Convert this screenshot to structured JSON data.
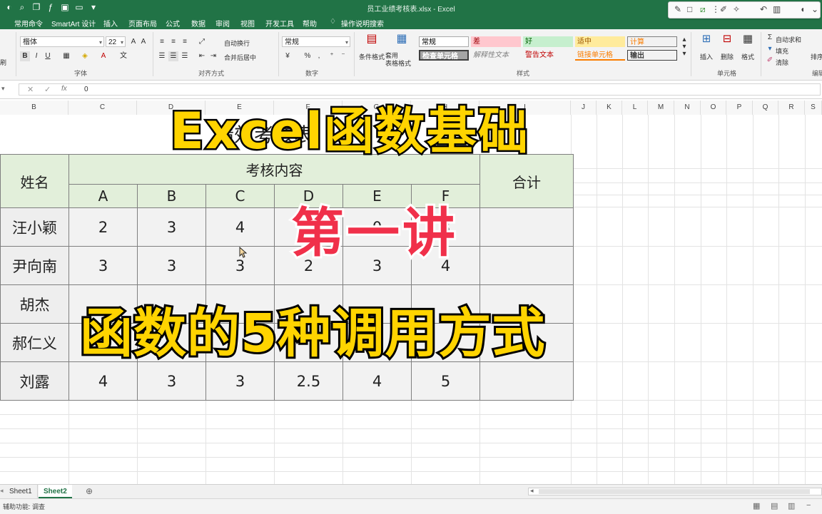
{
  "window": {
    "title": "员工业绩考核表.xlsx  -  Excel",
    "quick_access": [
      "autosave-icon",
      "undo-icon",
      "redo-icon",
      "save-icon",
      "more-icon"
    ]
  },
  "ribbon_tabs": [
    "常用命令",
    "SmartArt 设计",
    "插入",
    "页面布局",
    "公式",
    "数据",
    "审阅",
    "视图",
    "开发工具",
    "帮助",
    "操作说明搜索"
  ],
  "ribbon": {
    "font": {
      "name": "楷体",
      "size": "22",
      "group_label": "字体"
    },
    "alignment": {
      "wrap_text": "自动换行",
      "merge_center": "合并后居中",
      "group_label": "对齐方式"
    },
    "number": {
      "format": "常规",
      "percent": "%",
      "comma": ",",
      "group_label": "数字"
    },
    "styles": {
      "conditional_format": "条件格式",
      "table_format": "套用\n表格格式",
      "cells": [
        {
          "label": "常规",
          "bg": "#ffffff",
          "fg": "#000000"
        },
        {
          "label": "差",
          "bg": "#ffc7ce",
          "fg": "#9c0006"
        },
        {
          "label": "好",
          "bg": "#c6efce",
          "fg": "#006100"
        },
        {
          "label": "适中",
          "bg": "#ffeb9c",
          "fg": "#9c5700"
        },
        {
          "label": "计算",
          "bg": "#f2f2f2",
          "fg": "#fa7d00"
        },
        {
          "label": "检查单元格",
          "bg": "#a5a5a5",
          "fg": "#ffffff"
        },
        {
          "label": "解释性文本",
          "bg": "#f3f3f3",
          "fg": "#7f7f7f"
        },
        {
          "label": "警告文本",
          "bg": "#f3f3f3",
          "fg": "#c00000"
        },
        {
          "label": "链接单元格",
          "bg": "#f3f3f3",
          "fg": "#fa7d00"
        },
        {
          "label": "输出",
          "bg": "#f2f2f2",
          "fg": "#3f3f3f"
        }
      ],
      "group_label": "样式"
    },
    "cells_group": {
      "insert": "插入",
      "delete": "删除",
      "format": "格式",
      "group_label": "单元格"
    },
    "editing": {
      "autosum": "自动求和",
      "fill": "填充",
      "clear": "清除",
      "sort": "排序",
      "group_label": "编辑"
    },
    "clipboard_label": "剪贴板"
  },
  "formula_bar": {
    "value": "0",
    "fx": "fx"
  },
  "columns": [
    "B",
    "C",
    "D",
    "E",
    "F",
    "G",
    "H",
    "I",
    "J",
    "K",
    "L",
    "M",
    "N",
    "O",
    "P",
    "Q",
    "R",
    "S"
  ],
  "sheet": {
    "title": "绩效考核表",
    "header_name": "姓名",
    "header_group": "考核内容",
    "header_total": "合计",
    "sub_headers": [
      "A",
      "B",
      "C",
      "D",
      "E",
      "F"
    ],
    "rows": [
      {
        "name": "汪小颖",
        "values": [
          "2",
          "3",
          "4",
          "2",
          "0",
          "3"
        ],
        "total": ""
      },
      {
        "name": "尹向南",
        "values": [
          "3",
          "3",
          "3",
          "2",
          "3",
          "4"
        ],
        "total": ""
      },
      {
        "name": "胡杰",
        "values": [
          "",
          "",
          "",
          "",
          "",
          ""
        ],
        "total": ""
      },
      {
        "name": "郝仁义",
        "values": [
          "",
          "",
          "",
          "",
          "",
          ""
        ],
        "total": ""
      },
      {
        "name": "刘露",
        "values": [
          "4",
          "3",
          "3",
          "2.5",
          "4",
          "5"
        ],
        "total": ""
      }
    ]
  },
  "overlay": {
    "main_title": "Excel函数基础",
    "lecture": "第一讲",
    "subtitle": "函数的5种调用方式"
  },
  "sheet_tabs": [
    {
      "label": "Sheet1",
      "active": false
    },
    {
      "label": "Sheet2",
      "active": true
    }
  ],
  "status": {
    "accessibility": "辅助功能: 调查"
  }
}
